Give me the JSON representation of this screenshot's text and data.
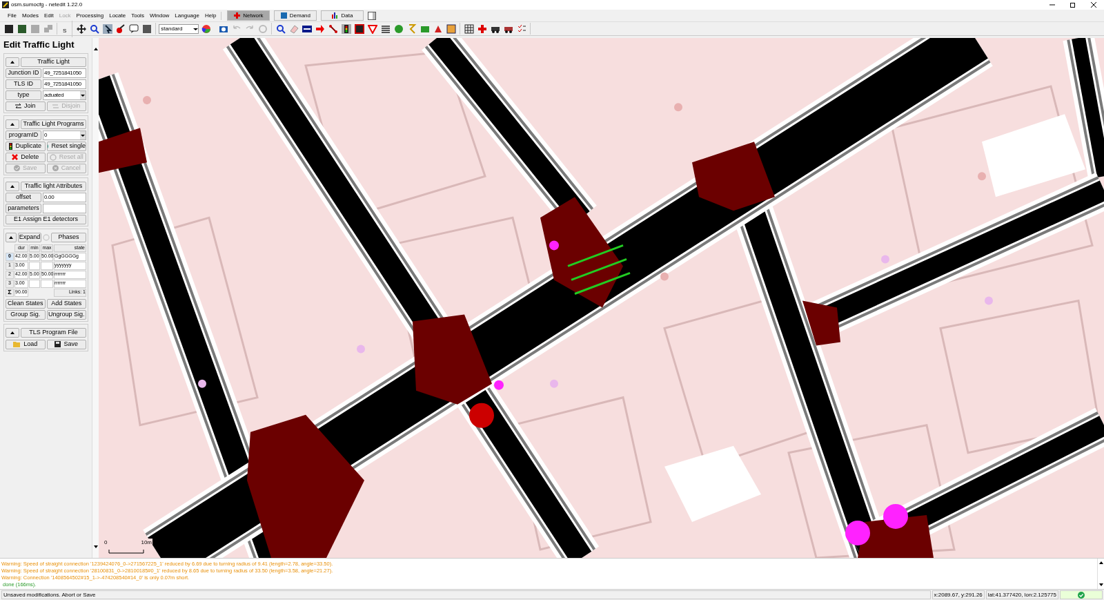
{
  "window": {
    "title": "osm.sumocfg - netedit 1.22.0"
  },
  "menu": [
    {
      "label": "File",
      "disabled": false
    },
    {
      "label": "Modes",
      "disabled": false
    },
    {
      "label": "Edit",
      "disabled": false
    },
    {
      "label": "Lock",
      "disabled": true
    },
    {
      "label": "Processing",
      "disabled": false
    },
    {
      "label": "Locate",
      "disabled": false
    },
    {
      "label": "Tools",
      "disabled": false
    },
    {
      "label": "Window",
      "disabled": false
    },
    {
      "label": "Language",
      "disabled": false
    },
    {
      "label": "Help",
      "disabled": false
    }
  ],
  "supermodes": [
    {
      "label": "Network",
      "selected": true
    },
    {
      "label": "Demand",
      "selected": false
    },
    {
      "label": "Data",
      "selected": false
    }
  ],
  "toolbar": {
    "s_button": "S",
    "scheme": "standard"
  },
  "panel": {
    "title": "Edit Traffic Light",
    "traffic_light": {
      "header": "Traffic Light",
      "fields": [
        {
          "label": "Junction ID",
          "value": "49_7251841050",
          "kind": "text"
        },
        {
          "label": "TLS ID",
          "value": "49_7251841050",
          "kind": "text"
        },
        {
          "label": "type",
          "value": "actuated",
          "kind": "select"
        }
      ],
      "buttons": [
        {
          "label": "Join",
          "disabled": false
        },
        {
          "label": "Disjoin",
          "disabled": true
        }
      ]
    },
    "programs": {
      "header": "Traffic Light Programs",
      "field": {
        "label": "programID",
        "value": "0"
      },
      "buttons": [
        {
          "label": "Duplicate",
          "disabled": false
        },
        {
          "label": "Reset single",
          "disabled": false
        },
        {
          "label": "Delete",
          "disabled": false
        },
        {
          "label": "Reset all",
          "disabled": true
        },
        {
          "label": "Save",
          "disabled": true
        },
        {
          "label": "Cancel",
          "disabled": true
        }
      ]
    },
    "attributes": {
      "header": "Traffic light Attributes",
      "fields": [
        {
          "label": "offset",
          "value": "0.00"
        },
        {
          "label": "parameters"
        }
      ],
      "button": "E1 Assign E1 detectors"
    },
    "phases": {
      "expand": "Expand",
      "header": "Phases",
      "columns": [
        "dur",
        "min",
        "max",
        "state"
      ],
      "rows": [
        {
          "index": "0",
          "dur": "42.00",
          "min": "5.00",
          "max": "50.00",
          "state": "GgGGGGg",
          "selected": true
        },
        {
          "index": "1",
          "dur": "3.00",
          "min": "",
          "max": "",
          "state": "yyyyyyy",
          "selected": false
        },
        {
          "index": "2",
          "dur": "42.00",
          "min": "5.00",
          "max": "50.00",
          "state": "rrrrrrr",
          "selected": false
        },
        {
          "index": "3",
          "dur": "3.00",
          "min": "",
          "max": "",
          "state": "rrrrrrr",
          "selected": false
        }
      ],
      "sum": {
        "symbol": "Σ",
        "total": "90.00",
        "links": "Links: 1"
      },
      "buttons": [
        "Clean States",
        "Add States",
        "Group Sig.",
        "Ungroup Sig."
      ]
    },
    "program_file": {
      "header": "TLS Program File",
      "buttons": [
        "Load",
        "Save"
      ]
    }
  },
  "map": {
    "scale_start": "0",
    "scale_end": "10m"
  },
  "messages": [
    {
      "kind": "warning",
      "text": "Warning: Speed of straight connection '1239424076_0->271567225_1' reduced by 6.69 due to turning radius of 9.41 (length=2.78, angle=33.50)."
    },
    {
      "kind": "warning",
      "text": "Warning: Speed of straight connection '28100831_0->28100185#0_1' reduced by 8.65 due to turning radius of 33.50 (length=3.58, angle=21.27)."
    },
    {
      "kind": "warning",
      "text": "Warning: Connection '1408564502#15_1->-474208540#14_0' is only 0.07m short."
    },
    {
      "kind": "done",
      "text": "done (166ms)."
    }
  ],
  "status_bar": {
    "message": "Unsaved modifications. Abort or Save",
    "coords": "x:2089.67, y:291.26",
    "geo": "lat:41.377420, lon:2.125775"
  }
}
